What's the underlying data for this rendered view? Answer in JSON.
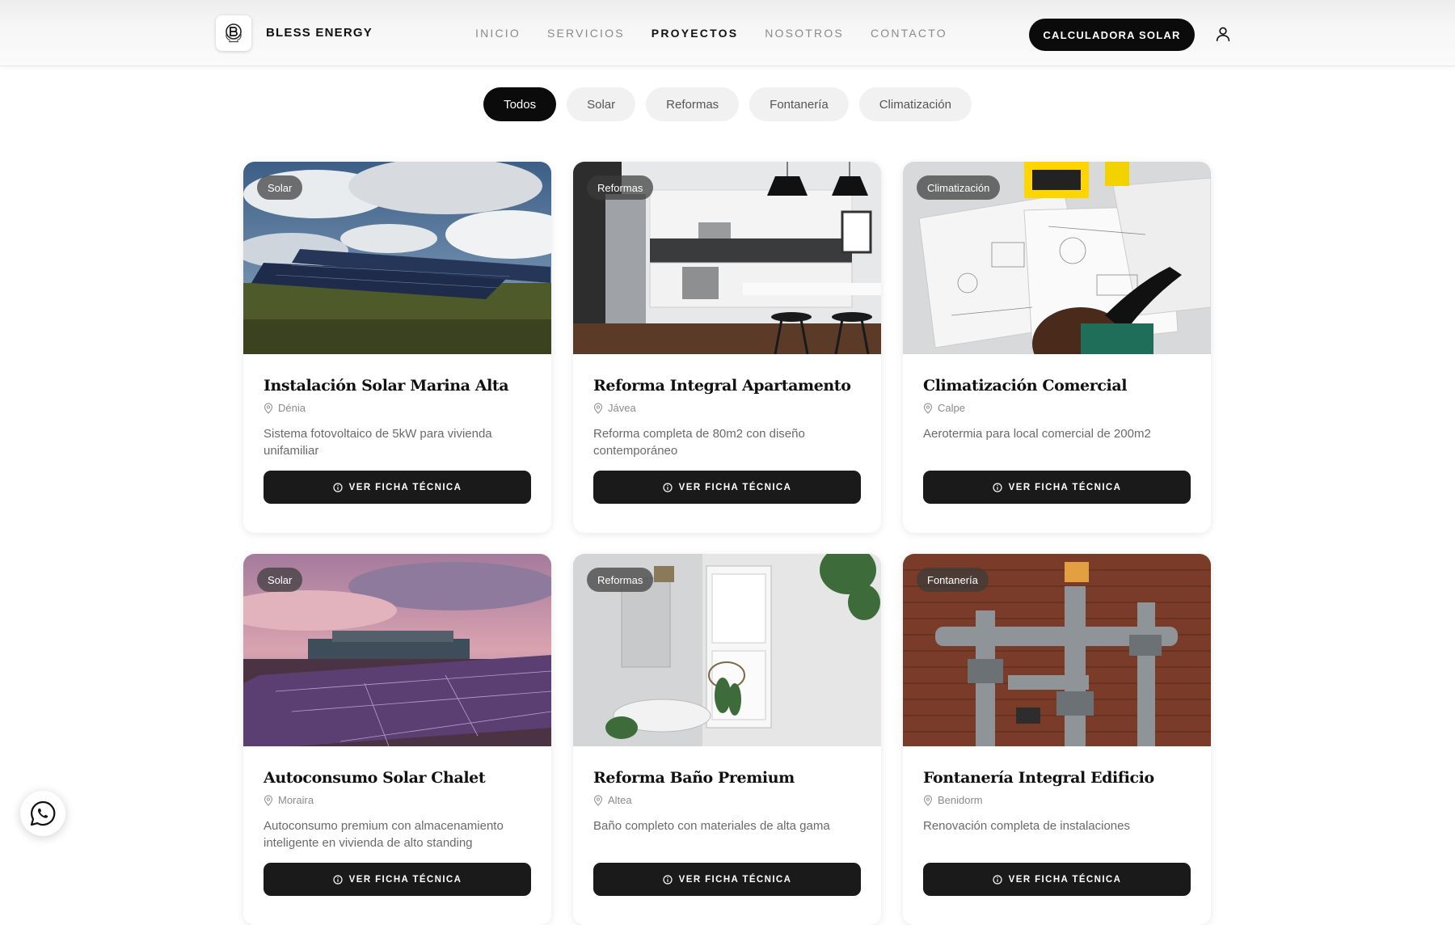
{
  "header": {
    "brand": "BLESS ENERGY",
    "nav": [
      "INICIO",
      "SERVICIOS",
      "PROYECTOS",
      "NOSOTROS",
      "CONTACTO"
    ],
    "active_nav": "PROYECTOS",
    "cta_label": "CALCULADORA SOLAR"
  },
  "filters": [
    "Todos",
    "Solar",
    "Reformas",
    "Fontanería",
    "Climatización"
  ],
  "active_filter": "Todos",
  "projects": [
    {
      "category": "Solar",
      "title": "Instalación Solar Marina Alta",
      "location": "Dénia",
      "description": "Sistema fotovoltaico de 5kW para vivienda unifamiliar",
      "button": "VER FICHA TÉCNICA"
    },
    {
      "category": "Reformas",
      "title": "Reforma Integral Apartamento",
      "location": "Jávea",
      "description": "Reforma completa de 80m2 con diseño contemporáneo",
      "button": "VER FICHA TÉCNICA"
    },
    {
      "category": "Climatización",
      "title": "Climatización Comercial",
      "location": "Calpe",
      "description": "Aerotermia para local comercial de 200m2",
      "button": "VER FICHA TÉCNICA"
    },
    {
      "category": "Solar",
      "title": "Autoconsumo Solar Chalet",
      "location": "Moraira",
      "description": "Autoconsumo premium con almacenamiento inteligente en vivienda de alto standing",
      "button": "VER FICHA TÉCNICA"
    },
    {
      "category": "Reformas",
      "title": "Reforma Baño Premium",
      "location": "Altea",
      "description": "Baño completo con materiales de alta gama",
      "button": "VER FICHA TÉCNICA"
    },
    {
      "category": "Fontanería",
      "title": "Fontanería Integral Edificio",
      "location": "Benidorm",
      "description": "Renovación completa de instalaciones",
      "button": "VER FICHA TÉCNICA"
    }
  ],
  "icons": {
    "user": "user-icon",
    "location": "map-pin-icon",
    "info": "info-icon",
    "whatsapp": "whatsapp-icon"
  }
}
